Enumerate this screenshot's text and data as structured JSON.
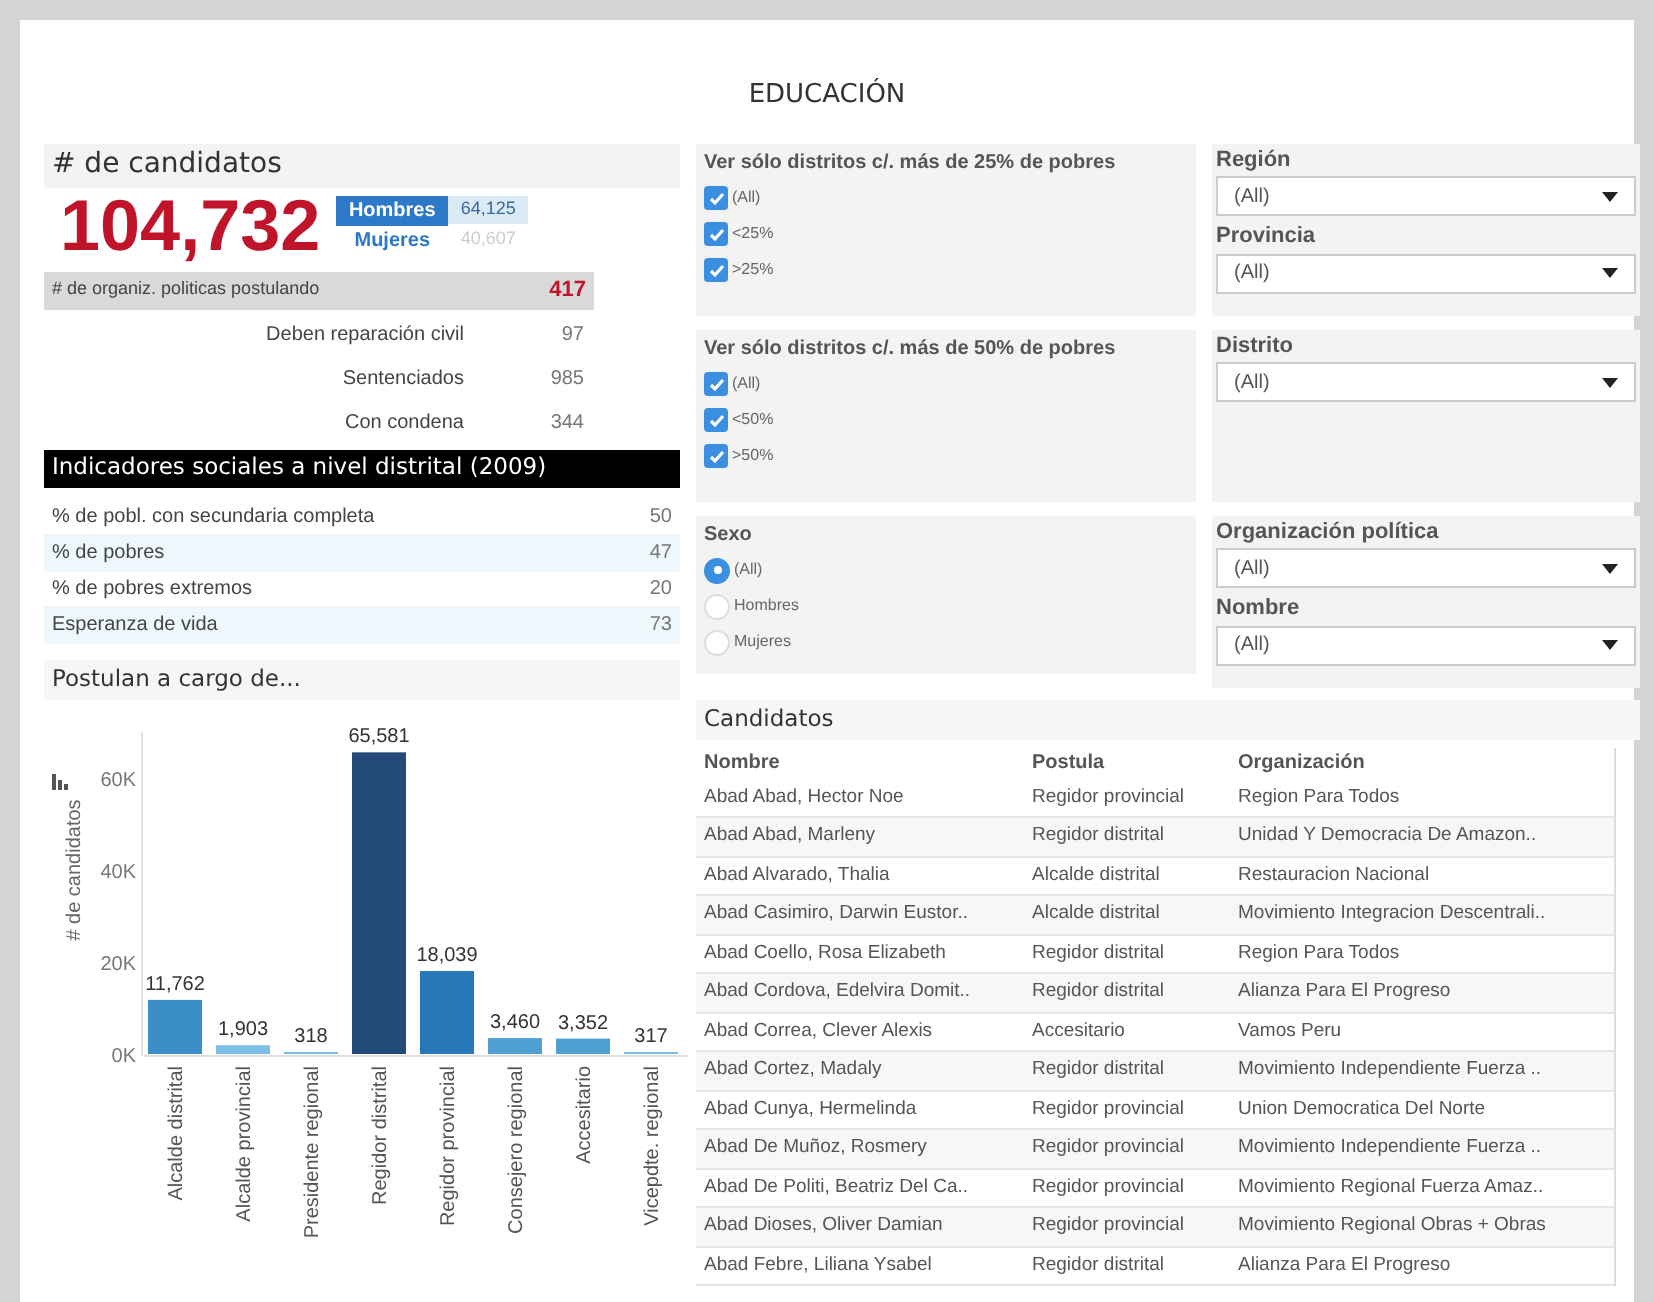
{
  "title": "EDUCACIÓN",
  "candidates": {
    "title": "# de candidatos",
    "total": "104,732",
    "sexes": [
      {
        "label": "Hombres",
        "value": "64,125",
        "selected": true
      },
      {
        "label": "Mujeres",
        "value": "40,607",
        "selected": false
      }
    ],
    "orgs": {
      "label": "# de organiz. politicas postulando",
      "value": "417"
    },
    "stats": [
      {
        "label": "Deben reparación civil",
        "value": "97"
      },
      {
        "label": "Sentenciados",
        "value": "985"
      },
      {
        "label": "Con condena",
        "value": "344"
      }
    ]
  },
  "indicators": {
    "title": "Indicadores sociales a nivel distrital (2009)",
    "rows": [
      {
        "label": "% de pobl. con secundaria completa",
        "value": "50"
      },
      {
        "label": "% de pobres",
        "value": "47"
      },
      {
        "label": "% de pobres extremos",
        "value": "20"
      },
      {
        "label": "Esperanza de vida",
        "value": "73"
      }
    ]
  },
  "filters": [
    {
      "title": "Ver sólo distritos c/. más de 25% de pobres",
      "kind": "checkbox",
      "options": [
        {
          "label": "(All)",
          "checked": true
        },
        {
          "label": "<25%",
          "checked": true
        },
        {
          "label": ">25%",
          "checked": true
        }
      ]
    },
    {
      "title": "Ver sólo distritos c/. más de 50% de pobres",
      "kind": "checkbox",
      "options": [
        {
          "label": "(All)",
          "checked": true
        },
        {
          "label": "<50%",
          "checked": true
        },
        {
          "label": ">50%",
          "checked": true
        }
      ]
    },
    {
      "title": "Sexo",
      "kind": "radio",
      "options": [
        {
          "label": "(All)",
          "checked": true
        },
        {
          "label": "Hombres",
          "checked": false
        },
        {
          "label": "Mujeres",
          "checked": false
        }
      ]
    }
  ],
  "dropdown_groups": [
    [
      {
        "label": "Región",
        "value": "(All)"
      },
      {
        "label": "Provincia",
        "value": "(All)"
      }
    ],
    [
      {
        "label": "Distrito",
        "value": "(All)"
      }
    ],
    [
      {
        "label": "Organización política",
        "value": "(All)"
      },
      {
        "label": "Nombre",
        "value": "(All)"
      }
    ]
  ],
  "chart": {
    "title": "Postulan a cargo de...",
    "chart_data": {
      "type": "bar",
      "ylabel": "# de candidatos",
      "categories": [
        "Alcalde distrital",
        "Alcalde provincial",
        "Presidente regional",
        "Regidor distrital",
        "Regidor provincial",
        "Consejero regional",
        "Accesitario",
        "Vicepdte. regional"
      ],
      "values": [
        11762,
        1903,
        318,
        65581,
        18039,
        3460,
        3352,
        317
      ],
      "value_labels": [
        "11,762",
        "1,903",
        "318",
        "65,581",
        "18,039",
        "3,460",
        "3,352",
        "317"
      ],
      "ylim": [
        0,
        70000
      ],
      "yticks": [
        {
          "value": 0,
          "label": "0K"
        },
        {
          "value": 20000,
          "label": "20K"
        },
        {
          "value": 40000,
          "label": "40K"
        },
        {
          "value": 60000,
          "label": "60K"
        }
      ]
    }
  },
  "table": {
    "title": "Candidatos",
    "columns": [
      "Nombre",
      "Postula",
      "Organización"
    ],
    "rows": [
      [
        "Abad Abad, Hector Noe",
        "Regidor provincial",
        "Region Para Todos"
      ],
      [
        "Abad Abad, Marleny",
        "Regidor distrital",
        "Unidad Y Democracia De Amazon.."
      ],
      [
        "Abad Alvarado, Thalia",
        "Alcalde distrital",
        "Restauracion Nacional"
      ],
      [
        "Abad Casimiro, Darwin Eustor..",
        "Alcalde distrital",
        "Movimiento Integracion Descentrali.."
      ],
      [
        "Abad Coello, Rosa Elizabeth",
        "Regidor distrital",
        "Region Para Todos"
      ],
      [
        "Abad Cordova, Edelvira Domit..",
        "Regidor distrital",
        "Alianza Para El Progreso"
      ],
      [
        "Abad Correa, Clever Alexis",
        "Accesitario",
        "Vamos Peru"
      ],
      [
        "Abad Cortez, Madaly",
        "Regidor distrital",
        "Movimiento Independiente Fuerza .."
      ],
      [
        "Abad Cunya, Hermelinda",
        "Regidor provincial",
        "Union Democratica Del Norte"
      ],
      [
        "Abad De Muñoz, Rosmery",
        "Regidor provincial",
        "Movimiento Independiente Fuerza .."
      ],
      [
        "Abad De Politi, Beatriz Del Ca..",
        "Regidor provincial",
        "Movimiento Regional Fuerza Amaz.."
      ],
      [
        "Abad Dioses, Oliver Damian",
        "Regidor provincial",
        "Movimiento Regional Obras + Obras"
      ],
      [
        "Abad Febre, Liliana Ysabel",
        "Regidor distrital",
        "Alianza Para El Progreso"
      ]
    ]
  }
}
